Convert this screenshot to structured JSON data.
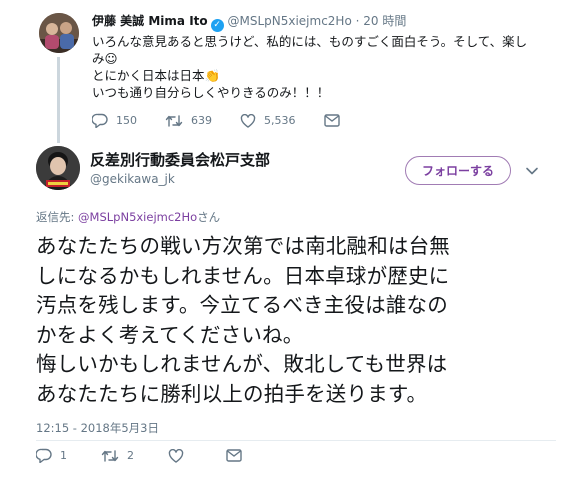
{
  "parent_tweet": {
    "display_name": "伊藤 美誠 Mima Ito",
    "handle": "@MSLpN5xiejmc2Ho",
    "separator": "·",
    "time": "20 時間",
    "lines": [
      "いろんな意見あると思うけど、私的には、ものすごく面白そう。そして、楽し",
      "み☺",
      "とにかく日本は日本👏",
      "いつも通り自分らしくやりきるのみ！！！"
    ],
    "actions": {
      "reply_count": "150",
      "retweet_count": "639",
      "like_count": "5,536"
    }
  },
  "main_tweet": {
    "display_name": "反差別行動委員会松戸支部",
    "handle": "@gekikawa_jk",
    "follow_label": "フォローする",
    "reply_prefix": "返信先: ",
    "reply_mention": "@MSLpN5xiejmc2Ho",
    "reply_suffix": "さん",
    "lines": [
      "あなたたちの戦い方次第では南北融和は台無",
      "しになるかもしれません。日本卓球が歴史に",
      "汚点を残します。今立てるべき主役は誰なの",
      "かをよく考えてくださいね。",
      "悔しいかもしれませんが、敗北しても世界は",
      "あなたたちに勝利以上の拍手を送ります。"
    ],
    "timestamp": "12:15 - 2018年5月3日",
    "actions": {
      "reply_count": "1",
      "retweet_count": "2",
      "like_count": ""
    }
  },
  "colors": {
    "accent": "#7b3fa0",
    "muted": "#657786",
    "verified": "#1da1f2",
    "text": "#14171a"
  }
}
